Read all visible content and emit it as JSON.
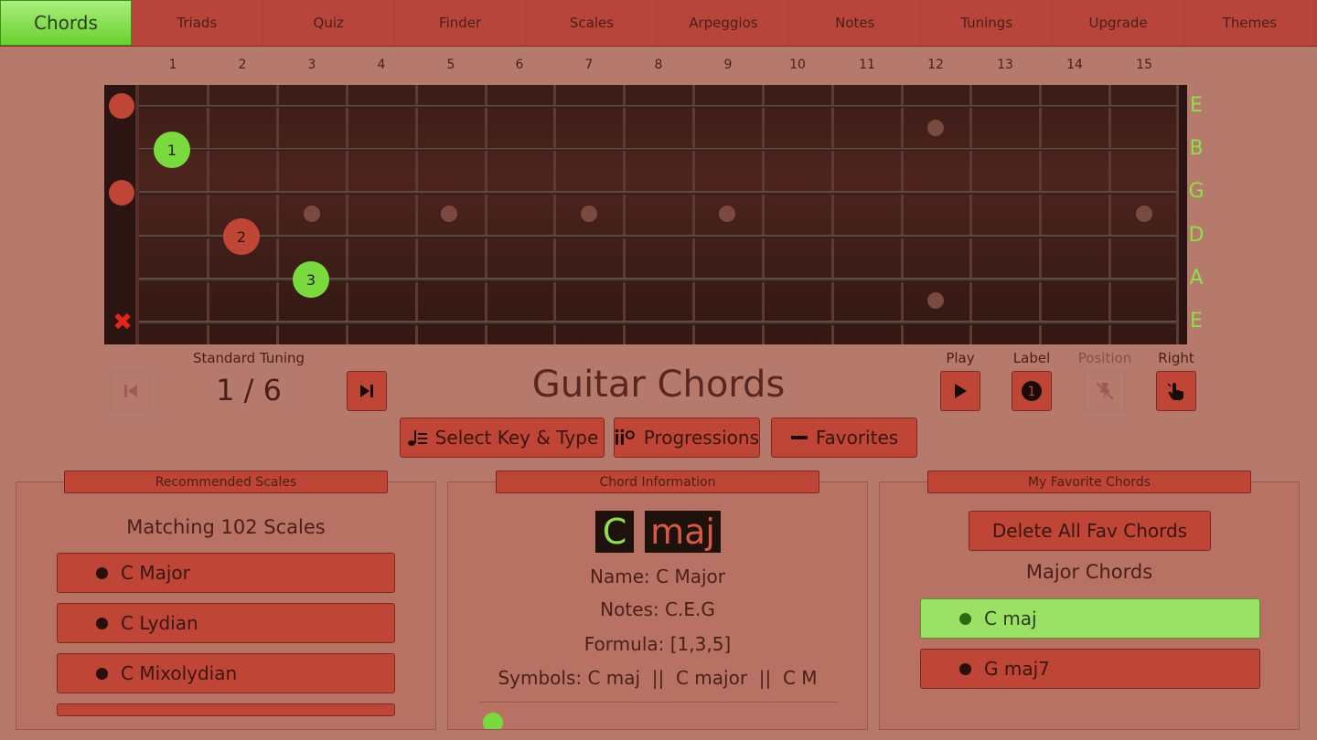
{
  "nav": {
    "tabs": [
      "Chords",
      "Triads",
      "Quiz",
      "Finder",
      "Scales",
      "Arpeggios",
      "Notes",
      "Tunings",
      "Upgrade",
      "Themes"
    ],
    "active_tab": "Chords"
  },
  "fretboard": {
    "fret_numbers": [
      "1",
      "2",
      "3",
      "4",
      "5",
      "6",
      "7",
      "8",
      "9",
      "10",
      "11",
      "12",
      "13",
      "14",
      "15"
    ],
    "string_names": [
      "E",
      "B",
      "G",
      "D",
      "A",
      "E"
    ],
    "fingers": [
      {
        "label": "1",
        "string": 2,
        "fret": 1,
        "color": "green"
      },
      {
        "label": "2",
        "string": 4,
        "fret": 2,
        "color": "red"
      },
      {
        "label": "3",
        "string": 5,
        "fret": 3,
        "color": "green"
      }
    ],
    "open_strings": [
      1,
      3
    ],
    "muted_strings": [
      6
    ]
  },
  "controls": {
    "tuning_label": "Standard Tuning",
    "counter": "1 / 6",
    "title": "Guitar Chords",
    "play_label": "Play",
    "label_label": "Label",
    "position_label": "Position",
    "right_label": "Right",
    "select_key_label": "Select Key & Type",
    "progressions_label": "Progressions",
    "favorites_label": "Favorites"
  },
  "scales_panel": {
    "header": "Recommended Scales",
    "subtitle": "Matching 102 Scales",
    "items": [
      "C Major",
      "C Lydian",
      "C Mixolydian"
    ]
  },
  "chord_panel": {
    "header": "Chord Information",
    "root": "C",
    "quality": "maj",
    "name_line": "Name: C Major",
    "notes_line": "Notes: C.E.G",
    "formula_line": "Formula: [1,3,5]",
    "symbols_line": "Symbols: C maj  ||  C major  ||  C M"
  },
  "favorites_panel": {
    "header": "My Favorite Chords",
    "delete_label": "Delete All Fav Chords",
    "group_label": "Major Chords",
    "items": [
      {
        "label": "C maj",
        "selected": true
      },
      {
        "label": "G maj7",
        "selected": false
      }
    ]
  },
  "colors": {
    "accent_green": "#79d93d",
    "accent_red": "#bf4637",
    "background": "#b57a6c"
  }
}
